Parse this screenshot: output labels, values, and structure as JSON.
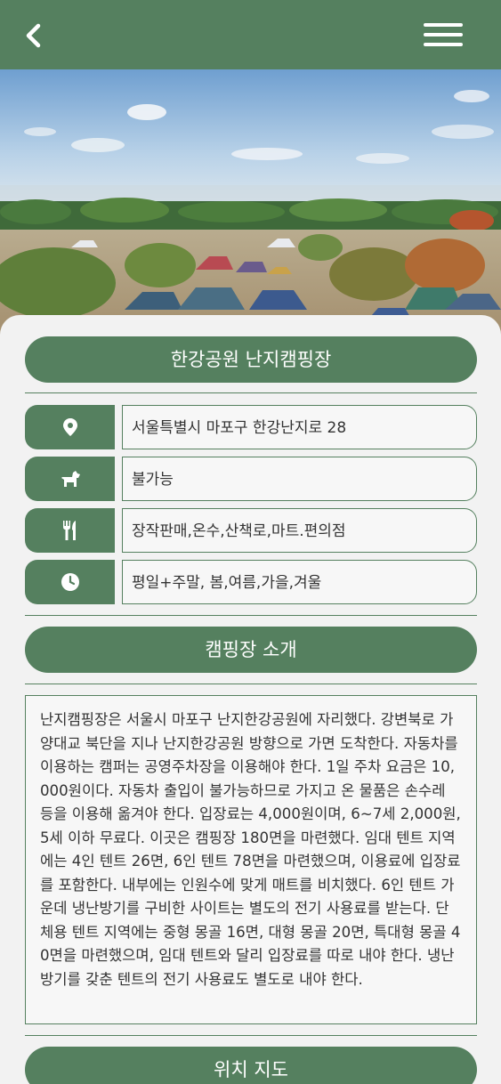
{
  "header": {
    "back_icon": "chevron-left-icon",
    "menu_icon": "hamburger-menu-icon",
    "bg_color": "#55805f"
  },
  "hero": {
    "image": "campground-photo"
  },
  "title": "한강공원 난지캠핑장",
  "info": [
    {
      "icon": "location-pin-icon",
      "text": "서울특별시 마포구 한강난지로 28"
    },
    {
      "icon": "dog-icon",
      "text": "불가능"
    },
    {
      "icon": "fork-knife-icon",
      "text": "장작판매,온수,산책로,마트.편의점"
    },
    {
      "icon": "clock-icon",
      "text": "평일+주말, 봄,여름,가을,겨울"
    }
  ],
  "intro": {
    "heading": "캠핑장 소개",
    "text": "난지캠핑장은 서울시 마포구 난지한강공원에 자리했다. 강변북로 가양대교 북단을 지나 난지한강공원 방향으로 가면 도착한다. 자동차를 이용하는 캠퍼는 공영주차장을 이용해야 한다. 1일 주차 요금은 10,000원이다. 자동차 출입이 불가능하므로 가지고 온 물품은 손수레 등을 이용해 옮겨야 한다. 입장료는 4,000원이며, 6~7세 2,000원, 5세 이하 무료다. 이곳은 캠핑장 180면을 마련했다. 임대 텐트 지역에는 4인 텐트 26면, 6인 텐트 78면을 마련했으며, 이용료에 입장료를 포함한다. 내부에는 인원수에 맞게 매트를 비치했다. 6인 텐트 가운데 냉난방기를 구비한 사이트는 별도의 전기 사용료를 받는다. 단체용 텐트 지역에는 중형 몽골 16면, 대형 몽골 20면, 특대형 몽골 40면을 마련했으며, 임대 텐트와 달리 입장료를 따로 내야 한다. 냉난방기를 갖춘 텐트의 전기 사용료도 별도로 내야 한다."
  },
  "map": {
    "heading": "위치 지도"
  }
}
